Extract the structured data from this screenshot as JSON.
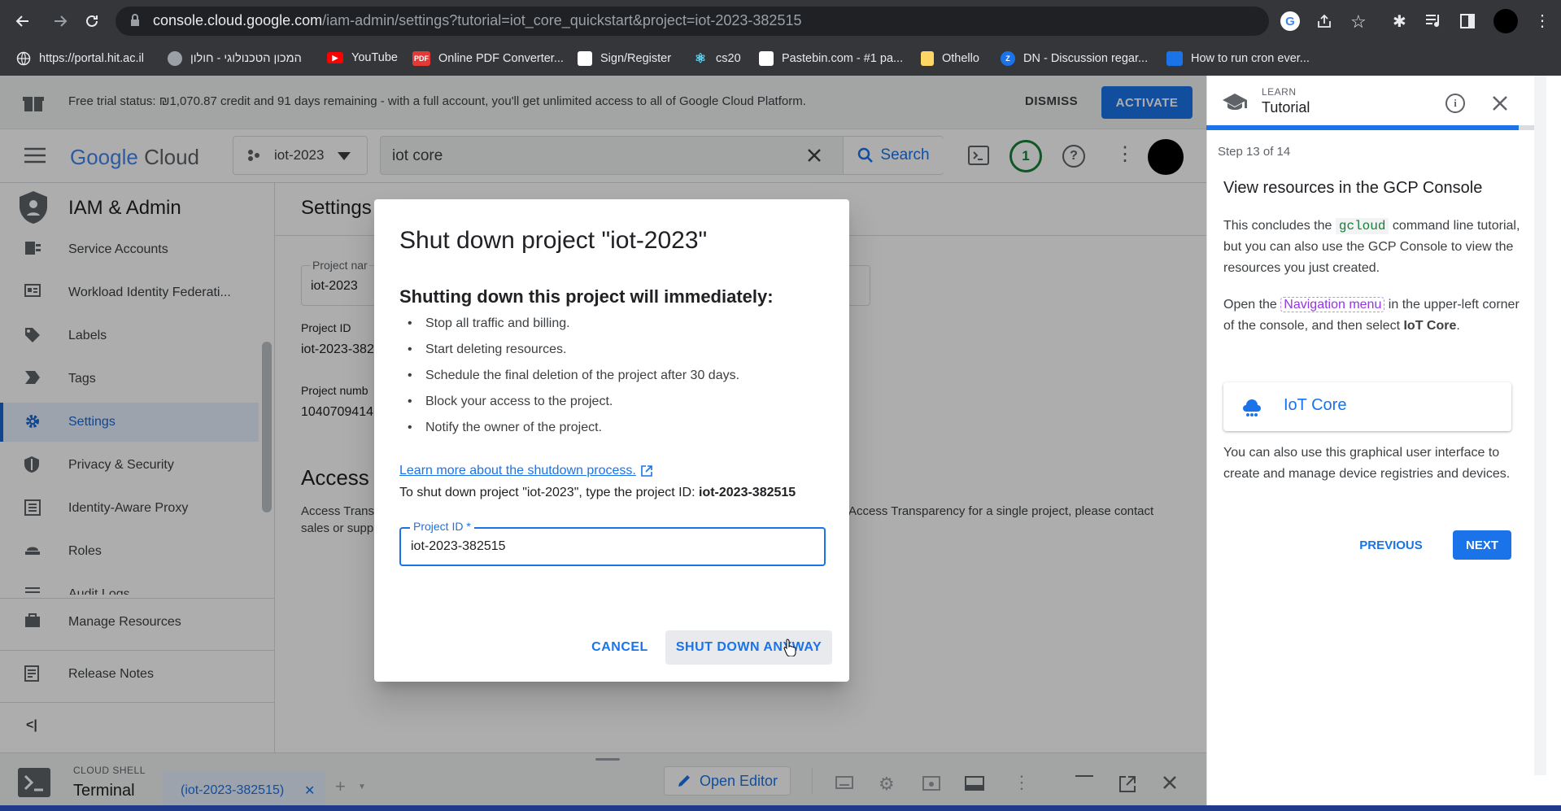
{
  "browser": {
    "url_host": "console.cloud.google.com",
    "url_path": "/iam-admin/settings?tutorial=iot_core_quickstart&project=iot-2023-382515",
    "bookmarks": [
      {
        "label": "https://portal.hit.ac.il",
        "color": "#ffffff"
      },
      {
        "label": "המכון הטכנולוגי - חולון",
        "color": "#9aa0a6"
      },
      {
        "label": "YouTube",
        "color": "#ff0000"
      },
      {
        "label": "Online PDF Converter...",
        "color": "#e53935"
      },
      {
        "label": "Sign/Register",
        "color": "#ffffff"
      },
      {
        "label": "cs20",
        "color": "#61dafb"
      },
      {
        "label": "Pastebin.com - #1 pa...",
        "color": "#ffffff"
      },
      {
        "label": "Othello",
        "color": "#fdd663"
      },
      {
        "label": "DN - Discussion regar...",
        "color": "#1a73e8"
      },
      {
        "label": "How to run cron ever...",
        "color": "#1a73e8"
      }
    ],
    "pdf_badge": "PDF",
    "z_badge": "Z"
  },
  "trial": {
    "text": "Free trial status: ₪1,070.87 credit and 91 days remaining - with a full account, you'll get unlimited access to all of Google Cloud Platform.",
    "dismiss": "DISMISS",
    "activate": "ACTIVATE"
  },
  "topbar": {
    "logo_google": "Google",
    "logo_cloud": "Cloud",
    "project": "iot-2023",
    "search_value": "iot core",
    "search_button": "Search",
    "notif_count": "1"
  },
  "sidenav": {
    "title": "IAM & Admin",
    "items": [
      {
        "label": "Service Accounts"
      },
      {
        "label": "Workload Identity Federati..."
      },
      {
        "label": "Labels"
      },
      {
        "label": "Tags"
      },
      {
        "label": "Settings"
      },
      {
        "label": "Privacy & Security"
      },
      {
        "label": "Identity-Aware Proxy"
      },
      {
        "label": "Roles"
      },
      {
        "label": "Audit Logs"
      }
    ],
    "manage_resources": "Manage Resources",
    "release_notes": "Release Notes",
    "collapse": "<|"
  },
  "content": {
    "heading": "Settings",
    "project_name_label": "Project nar",
    "project_name_value": "iot-2023",
    "project_id_label": "Project ID",
    "project_id_value": "iot-2023-382",
    "project_number_label": "Project numb",
    "project_number_value": "1040709414",
    "access_heading": "Access",
    "access_text_left": "Access Trans",
    "access_text_left2": "sales or supp",
    "access_text_right": "Access Transparency for a single project, please contact"
  },
  "dialog": {
    "title": "Shut down project \"iot-2023\"",
    "subtitle": "Shutting down this project will immediately:",
    "bullets": [
      "Stop all traffic and billing.",
      "Start deleting resources.",
      "Schedule the final deletion of the project after 30 days.",
      "Block your access to the project.",
      "Notify the owner of the project."
    ],
    "learn_link": "Learn more about the shutdown process.",
    "instruction_prefix": "To shut down project \"iot-2023\", type the project ID: ",
    "instruction_id": "iot-2023-382515",
    "field_label": "Project ID *",
    "field_value": "iot-2023-382515",
    "cancel": "CANCEL",
    "shutdown": "SHUT DOWN ANYWAY"
  },
  "shell": {
    "label": "CLOUD SHELL",
    "terminal": "Terminal",
    "tab": "(iot-2023-382515)",
    "open_editor": "Open Editor"
  },
  "tutorial": {
    "learn": "LEARN",
    "title": "Tutorial",
    "step": "Step 13 of 14",
    "heading": "View resources in the GCP Console",
    "p1_a": "This concludes the ",
    "p1_code": "gcloud",
    "p1_b": " command line tutorial, but you can also use the GCP Console to view the resources you just created.",
    "p2_a": "Open the ",
    "p2_chip": "Navigation menu",
    "p2_b": " in the upper-left corner of the console, and then select ",
    "p2_bold": "IoT Core",
    "p2_c": ".",
    "card": "IoT Core",
    "p3": "You can also use this graphical user interface to create and manage device registries and devices.",
    "previous": "PREVIOUS",
    "next": "NEXT",
    "progress": 0.93
  }
}
